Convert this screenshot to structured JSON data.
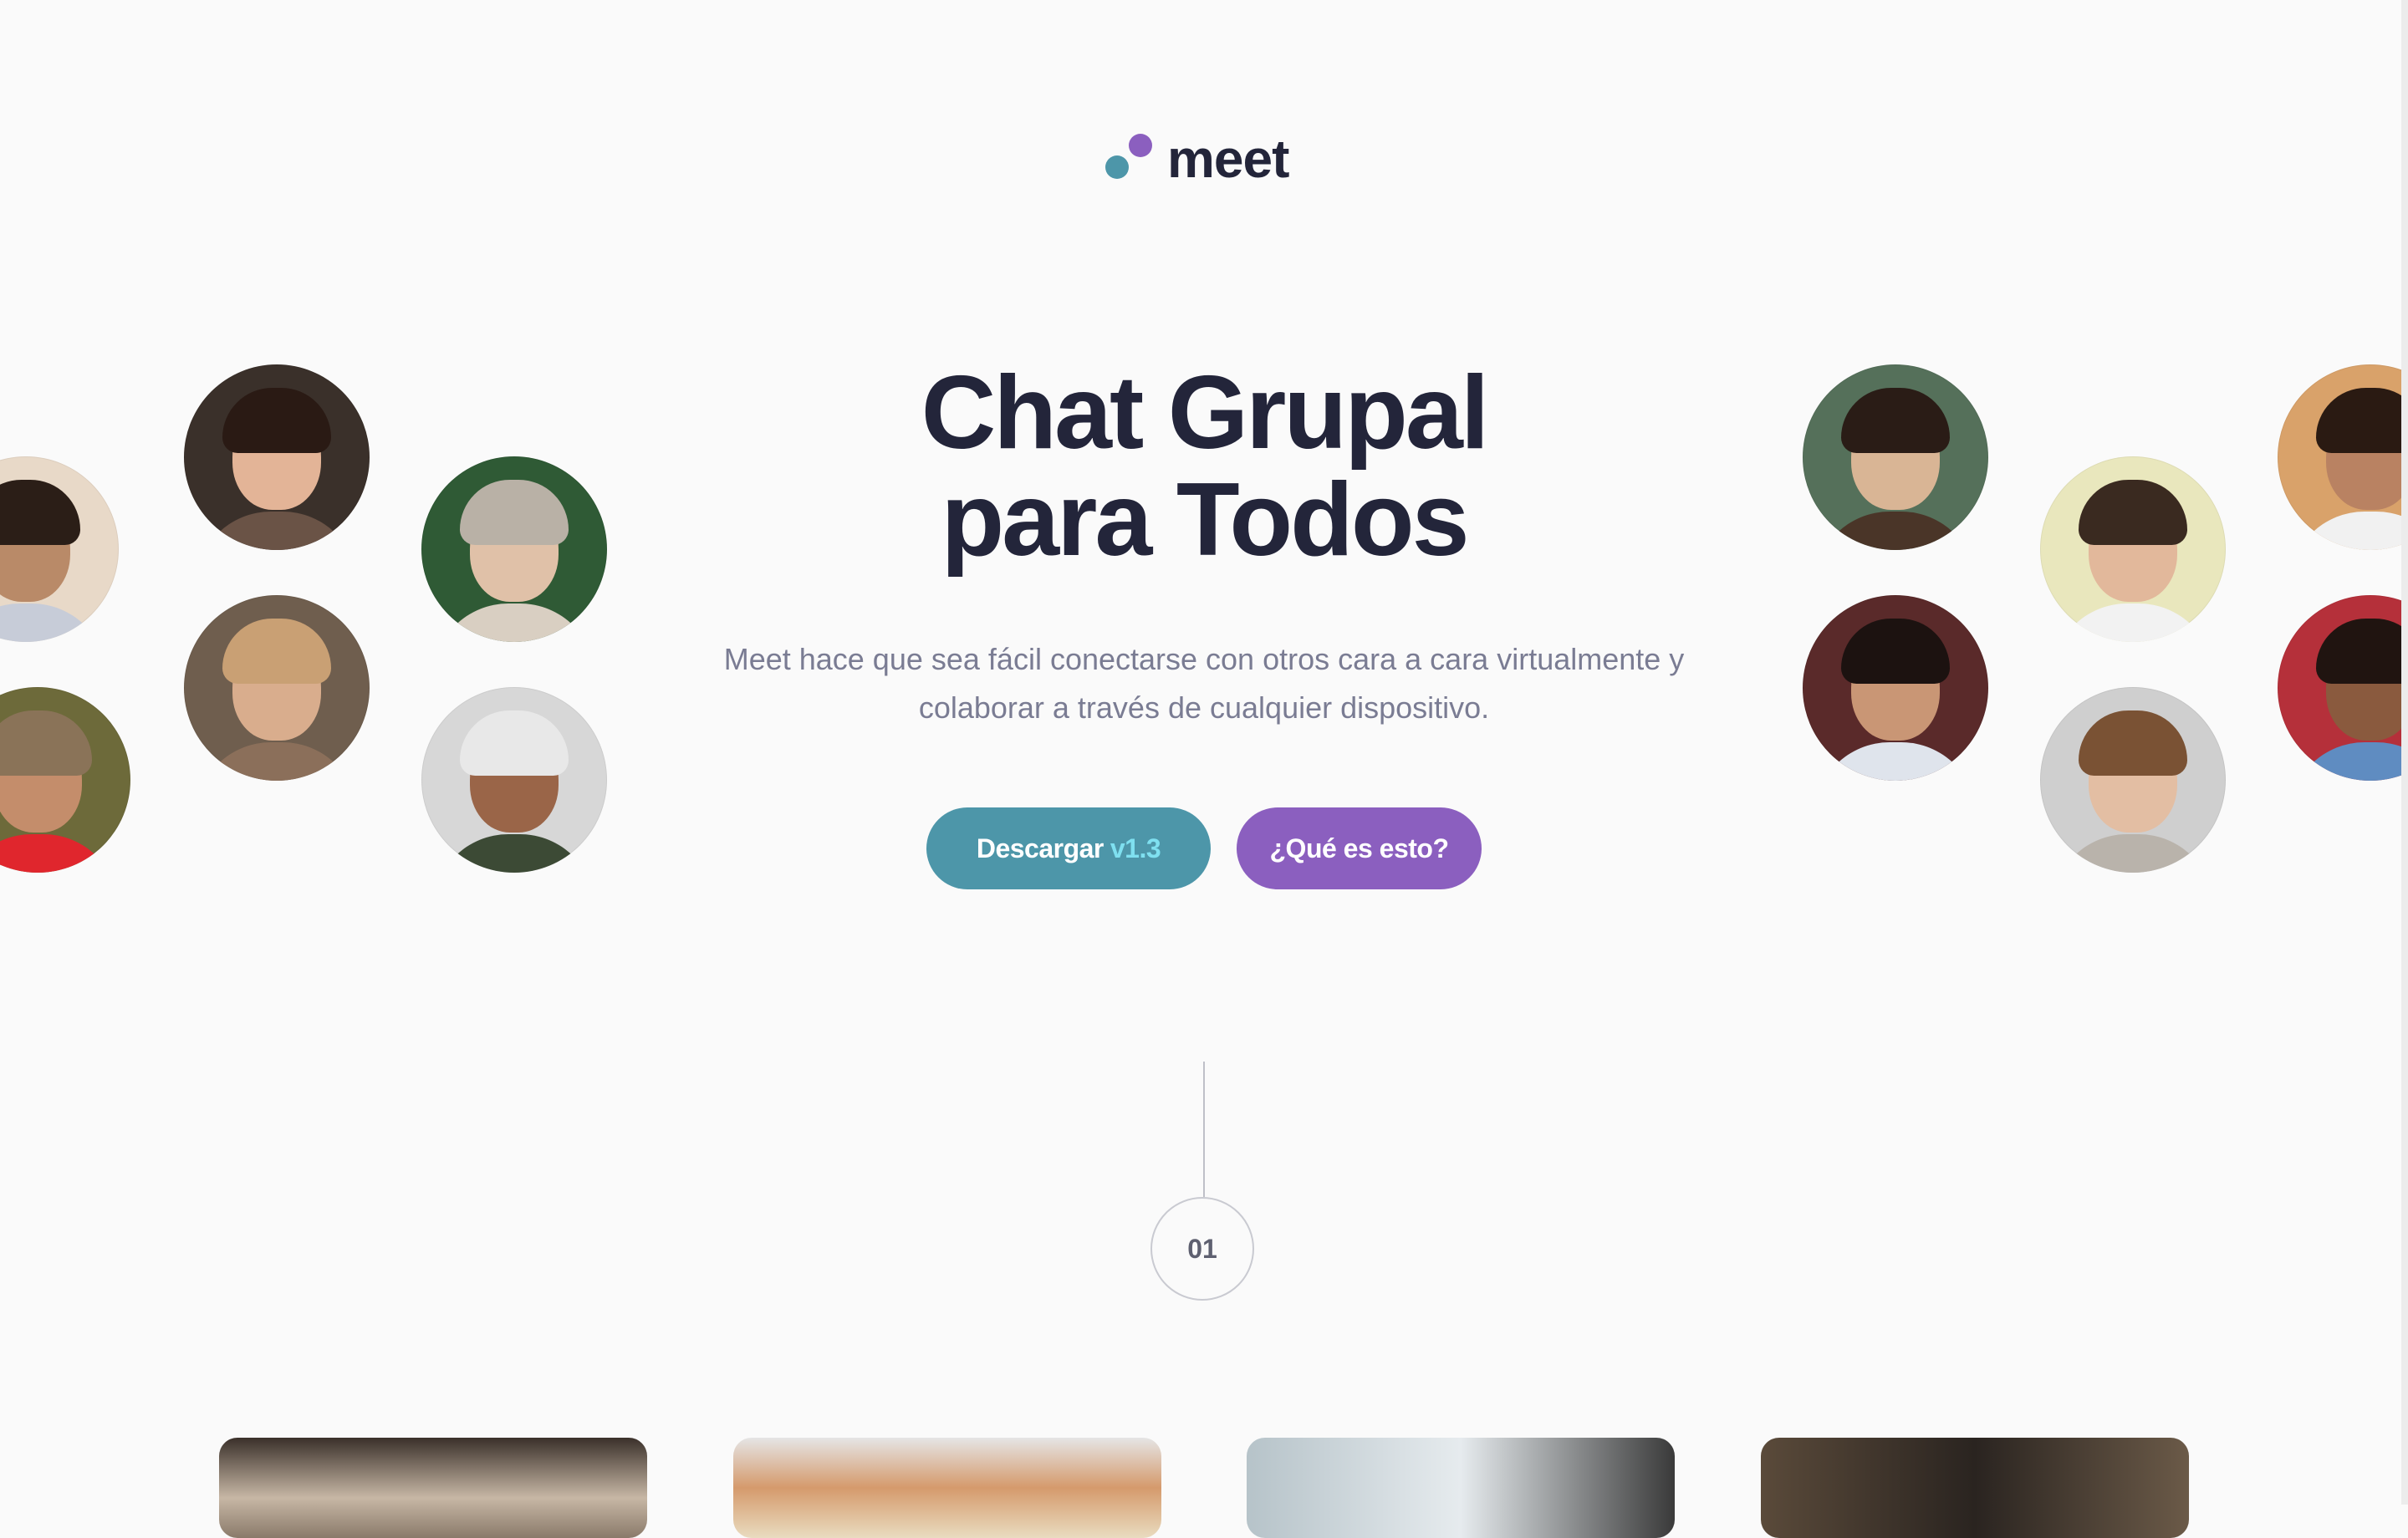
{
  "brand": {
    "name": "meet",
    "colors": {
      "teal": "#4d96a9",
      "purple": "#8b5fbf",
      "dark": "#23253a"
    }
  },
  "hero": {
    "title_line1": "Chat Grupal",
    "title_line2": "para Todos",
    "subtitle_line1": "Meet hace que sea fácil conectarse con otros cara a cara virtualmente y",
    "subtitle_line2": "colaborar a través de cualquier dispositivo.",
    "download_label": "Descargar",
    "download_version": "v1.3",
    "what_label": "¿Qué es esto?"
  },
  "step": {
    "number": "01"
  },
  "avatars_left": [
    {
      "name": "avatar-left-1"
    },
    {
      "name": "avatar-left-2"
    },
    {
      "name": "avatar-left-3"
    },
    {
      "name": "avatar-left-4"
    },
    {
      "name": "avatar-left-5"
    },
    {
      "name": "avatar-left-6"
    }
  ],
  "avatars_right": [
    {
      "name": "avatar-right-1"
    },
    {
      "name": "avatar-right-2"
    },
    {
      "name": "avatar-right-3"
    },
    {
      "name": "avatar-right-4"
    },
    {
      "name": "avatar-right-5"
    },
    {
      "name": "avatar-right-6"
    }
  ]
}
